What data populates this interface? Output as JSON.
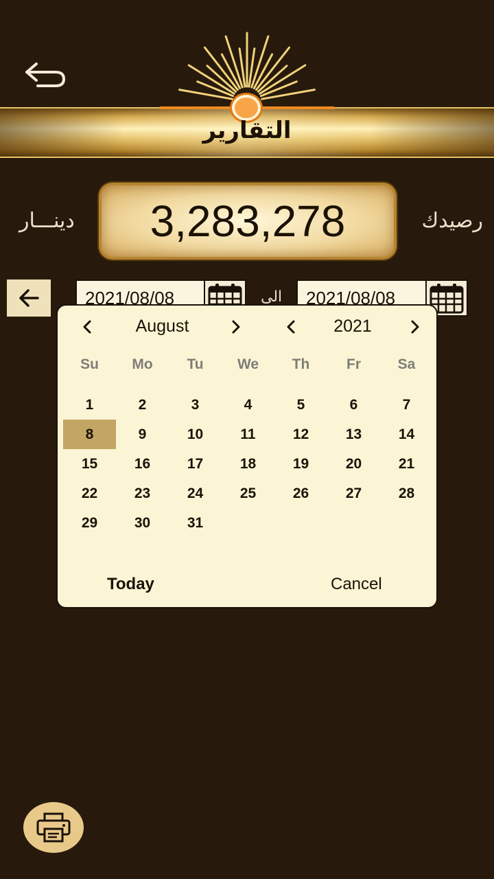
{
  "header": {
    "title": "التقارير",
    "back_icon": "back-arrow-icon"
  },
  "balance": {
    "label": "رصيدك",
    "value": "3,283,278",
    "currency": "دينـــار"
  },
  "date_filter": {
    "from_date": "2021/08/08",
    "to_label": "الى",
    "to_date": "2021/08/08"
  },
  "datepicker": {
    "month": "August",
    "year": "2021",
    "weekdays": [
      "Su",
      "Mo",
      "Tu",
      "We",
      "Th",
      "Fr",
      "Sa"
    ],
    "selected_day": 8,
    "first_weekday_index": 0,
    "days_in_month": 31,
    "today_label": "Today",
    "cancel_label": "Cancel"
  },
  "colors": {
    "background": "#271a0c",
    "gold": "#d9ae52",
    "accent_orange": "#f08a22",
    "popup_bg": "#fbf5d5",
    "selected_day": "#c3a564"
  }
}
